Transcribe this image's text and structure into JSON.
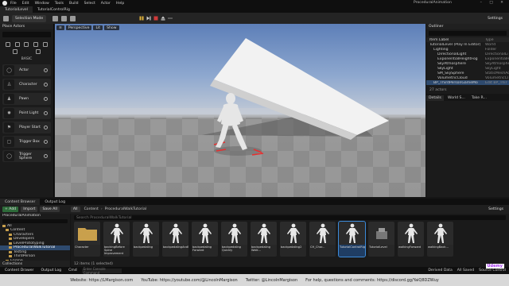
{
  "menu": {
    "items": [
      "File",
      "Edit",
      "Window",
      "Tools",
      "Build",
      "Select",
      "Actor",
      "Help"
    ],
    "project": "ProceduralAnimation",
    "window_controls": "– □ ✕"
  },
  "tabs": [
    {
      "label": "TutorialLevel",
      "active": true
    },
    {
      "label": "TutorialControlRig",
      "active": false
    }
  ],
  "toolbar": {
    "mode": "Selection Mode",
    "settings": "Settings"
  },
  "place_actors": {
    "title": "Place Actors",
    "category_title": "BASIC",
    "items": [
      "Actor",
      "Character",
      "Pawn",
      "Point Light",
      "Player Start",
      "Trigger Box",
      "Trigger Sphere"
    ]
  },
  "viewport": {
    "chips": [
      "Perspective",
      "Lit",
      "Show"
    ]
  },
  "outliner": {
    "title": "Outliner",
    "col_label": "Item Label",
    "col_type": "Type",
    "rows": [
      {
        "name": "TutorialLevel (Play In Editor)",
        "type": "World",
        "indent": 0,
        "sel": false
      },
      {
        "name": "Lighting",
        "type": "Folder",
        "indent": 1,
        "sel": false
      },
      {
        "name": "DirectionalLight",
        "type": "DirectionalLi",
        "indent": 2,
        "sel": false
      },
      {
        "name": "ExponentialHeightFog",
        "type": "ExponentialH",
        "indent": 2,
        "sel": false
      },
      {
        "name": "SkyAtmosphere",
        "type": "SkyAtmospher",
        "indent": 2,
        "sel": false
      },
      {
        "name": "SkyLight",
        "type": "SkyLight",
        "indent": 2,
        "sel": false
      },
      {
        "name": "SM_SkySphere",
        "type": "StaticMeshAc",
        "indent": 2,
        "sel": false
      },
      {
        "name": "VolumetricCloud",
        "type": "VolumetricCl",
        "indent": 2,
        "sel": false
      },
      {
        "name": "BP_ThirdPersonGameMo",
        "type": "Edit BP_Thir",
        "indent": 1,
        "sel": true
      }
    ],
    "count": "27 actors"
  },
  "details": {
    "tabs": [
      "Details",
      "World S...",
      "Take R..."
    ]
  },
  "content_browser": {
    "tabs": [
      "Content Browser",
      "Output Log"
    ],
    "add": "+ Add",
    "import": "Import",
    "save_all": "Save All",
    "all": "All",
    "breadcrumb": [
      "Content",
      "ProceduralWalkTutorial"
    ],
    "settings": "Settings",
    "root": "ProceduralAnimation",
    "search_placeholder": "Search ProceduralWalkTutorial",
    "tree": [
      {
        "label": "All",
        "indent": 0,
        "sel": false
      },
      {
        "label": "Content",
        "indent": 1,
        "sel": false
      },
      {
        "label": "Characters",
        "indent": 2,
        "sel": false
      },
      {
        "label": "Developers",
        "indent": 2,
        "sel": false
      },
      {
        "label": "LevelPrototyping",
        "indent": 2,
        "sel": false
      },
      {
        "label": "ProceduralWalkTutorial",
        "indent": 2,
        "sel": true
      },
      {
        "label": "Testing",
        "indent": 2,
        "sel": false
      },
      {
        "label": "ThirdPerson",
        "indent": 2,
        "sel": false
      },
      {
        "label": "Engine",
        "indent": 1,
        "sel": false
      }
    ],
    "assets": [
      {
        "label": "Character",
        "kind": "folder",
        "sel": false
      },
      {
        "label": "backingBefore Spine Improvement",
        "kind": "char",
        "sel": false
      },
      {
        "label": "backpedaling",
        "kind": "char",
        "sel": false
      },
      {
        "label": "backpedalingAndMore...",
        "kind": "char",
        "sel": false
      },
      {
        "label": "backpedaling Forward",
        "kind": "char",
        "sel": false
      },
      {
        "label": "backpedaling Quickly",
        "kind": "char",
        "sel": false
      },
      {
        "label": "backpedaling Walk...",
        "kind": "char",
        "sel": false
      },
      {
        "label": "backpedaling2",
        "kind": "char",
        "sel": false
      },
      {
        "label": "CH_Char...",
        "kind": "char",
        "sel": false
      },
      {
        "label": "TutorialControlRig",
        "kind": "char",
        "sel": true
      },
      {
        "label": "TutorialLevel",
        "kind": "level",
        "sel": false
      },
      {
        "label": "walkingForward",
        "kind": "char",
        "sel": false
      },
      {
        "label": "walkingBack...",
        "kind": "char",
        "sel": false
      }
    ],
    "count": "12 items (1 selected)",
    "collections": "Collections"
  },
  "status": {
    "content_drawer": "Content Drawer",
    "output_log": "Output Log",
    "cmd": "Cmd",
    "cmd_placeholder": "Enter Console Command",
    "derived_data": "Derived Data",
    "all_saved": "All Saved",
    "source_control": "Source Control"
  },
  "promo": {
    "website": "Website: https://LMargison.com",
    "youtube": "YouTube: https://youtube.com/@LincolnMargison",
    "twitter": "Twitter: @LincolnMargison",
    "help": "For help, questions and comments: https://discord.gg/YaiQ8DZWuy",
    "udemy": "Udemy"
  },
  "colors": {
    "selection": "#2e4a6e",
    "accent_blue": "#3b8ad9",
    "folder": "#c9a04c",
    "play_green": "#3fae49",
    "stop_red": "#d03a3a"
  }
}
